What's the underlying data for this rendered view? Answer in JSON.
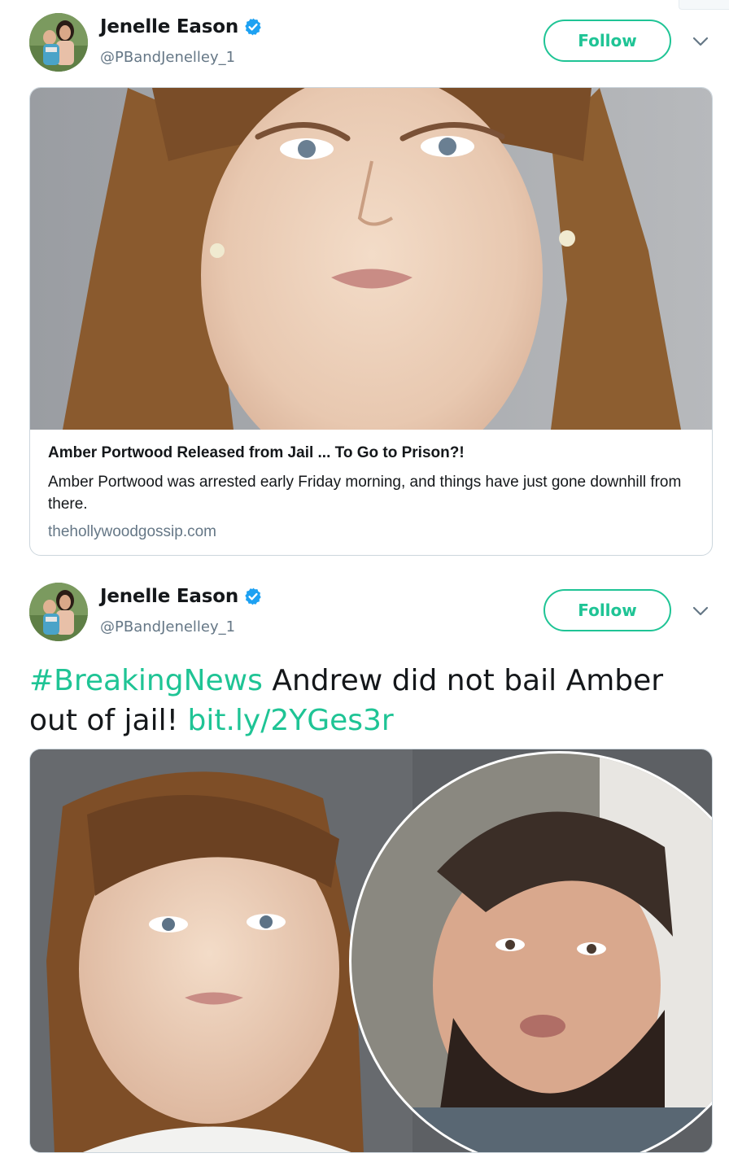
{
  "tweets": [
    {
      "author": {
        "name": "Jenelle Eason",
        "handle": "@PBandJenelley_1",
        "verified": true
      },
      "follow_label": "Follow",
      "card": {
        "title": "Amber Portwood Released from Jail ... To Go to Prison?!",
        "description": "Amber Portwood was arrested early Friday morning, and things have just gone downhill from there.",
        "domain": "thehollywoodgossip.com"
      }
    },
    {
      "author": {
        "name": "Jenelle Eason",
        "handle": "@PBandJenelley_1",
        "verified": true
      },
      "follow_label": "Follow",
      "text": {
        "hashtag": "#BreakingNews",
        "body": " Andrew did not bail Amber out of jail! ",
        "link": "bit.ly/2YGes3r"
      }
    }
  ],
  "colors": {
    "accent": "#1fc495",
    "verified": "#1da1f2",
    "text": "#14171a",
    "secondary": "#657786",
    "border": "#ccd6dd"
  },
  "icons": [
    "verified-badge-icon",
    "chevron-down-icon"
  ]
}
